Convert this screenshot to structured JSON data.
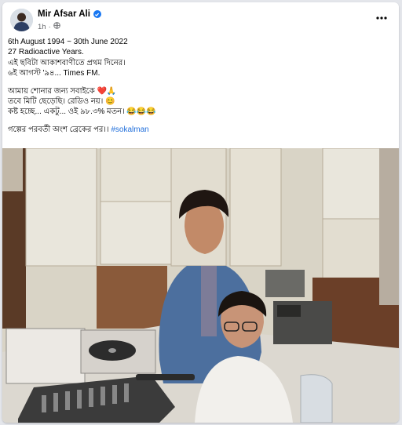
{
  "post": {
    "author": "Mir Afsar Ali",
    "time": "1h",
    "lines": [
      "6th August 1994 ~ 30th June 2022",
      "27 Radioactive Years.",
      "এই ছবিটা আকাশবাণীতে প্রথম দিনের।",
      "৬ই আগস্ট '৯৪... Times FM."
    ],
    "lines2": [
      "আমায় শোনার জন্য সবাইকে ❤️🙏",
      "তবে মিটি ছেড়েছি। রেডিও নয়। 😊",
      "কষ্ট হচ্ছে... একটু... ওই ৯৮.৩% মতন। 😂😂😂"
    ],
    "footer_text": "গল্পের পরবর্তী অংশ ব্রেকের পর।।",
    "hashtag": "#sokalman"
  },
  "icons": {
    "verified": "verified-badge-icon",
    "privacy": "globe-icon",
    "more": "more-options-icon"
  },
  "colors": {
    "accent": "#1877f2",
    "hashtag": "#216fdb",
    "secondary_text": "#65676b"
  }
}
